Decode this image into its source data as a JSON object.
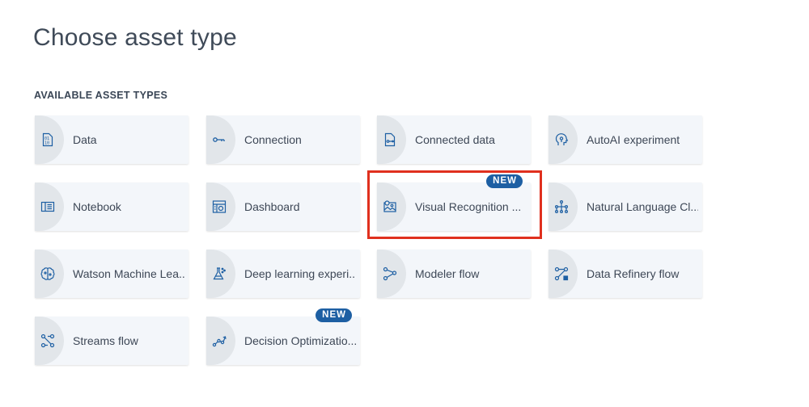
{
  "page": {
    "title": "Choose asset type",
    "section_label": "AVAILABLE ASSET TYPES"
  },
  "asset_types": [
    {
      "label": "Data",
      "icon": "data-file-icon"
    },
    {
      "label": "Connection",
      "icon": "connection-icon"
    },
    {
      "label": "Connected data",
      "icon": "connected-data-icon"
    },
    {
      "label": "AutoAI experiment",
      "icon": "autoai-head-icon"
    },
    {
      "label": "Notebook",
      "icon": "notebook-icon"
    },
    {
      "label": "Dashboard",
      "icon": "dashboard-icon"
    },
    {
      "label": "Visual Recognition ...",
      "icon": "visual-recognition-icon",
      "badge": "NEW"
    },
    {
      "label": "Natural Language Cl...",
      "icon": "nlc-icon"
    },
    {
      "label": "Watson Machine Lea...",
      "icon": "brain-icon"
    },
    {
      "label": "Deep learning experi...",
      "icon": "flask-icon"
    },
    {
      "label": "Modeler flow",
      "icon": "flow-icon"
    },
    {
      "label": "Data Refinery flow",
      "icon": "refinery-flow-icon"
    },
    {
      "label": "Streams flow",
      "icon": "streams-flow-icon"
    },
    {
      "label": "Decision Optimizatio...",
      "icon": "decision-optimization-icon",
      "badge": "NEW"
    }
  ],
  "colors": {
    "accent": "#1d5fa3",
    "highlight": "#e0301e",
    "tile_bg": "#f3f6fa"
  }
}
